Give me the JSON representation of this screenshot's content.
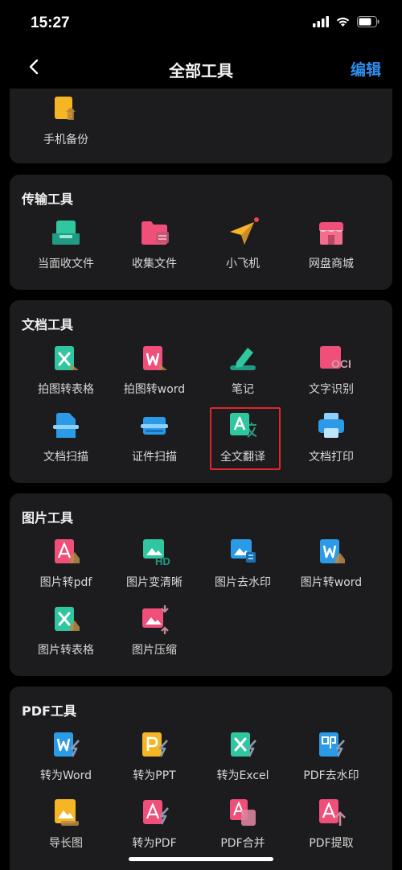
{
  "status": {
    "time": "15:27"
  },
  "nav": {
    "title": "全部工具",
    "edit": "编辑"
  },
  "sections": {
    "backup": {
      "items": [
        "手机备份"
      ]
    },
    "transfer": {
      "title": "传输工具",
      "items": [
        "当面收文件",
        "收集文件",
        "小飞机",
        "网盘商城"
      ]
    },
    "docs": {
      "title": "文档工具",
      "items": [
        "拍图转表格",
        "拍图转word",
        "笔记",
        "文字识别",
        "文档扫描",
        "证件扫描",
        "全文翻译",
        "文档打印"
      ]
    },
    "images": {
      "title": "图片工具",
      "items": [
        "图片转pdf",
        "图片变清晰",
        "图片去水印",
        "图片转word",
        "图片转表格",
        "图片压缩"
      ]
    },
    "pdf": {
      "title": "PDF工具",
      "items": [
        "转为Word",
        "转为PPT",
        "转为Excel",
        "PDF去水印",
        "导长图",
        "转为PDF",
        "PDF合并",
        "PDF提取"
      ]
    }
  },
  "icon_text": {
    "ocr": "OCR",
    "hd": "HD"
  },
  "colors": {
    "accent": "#2f8ff0",
    "highlight": "#e0262b",
    "card": "#1c1c1e"
  }
}
